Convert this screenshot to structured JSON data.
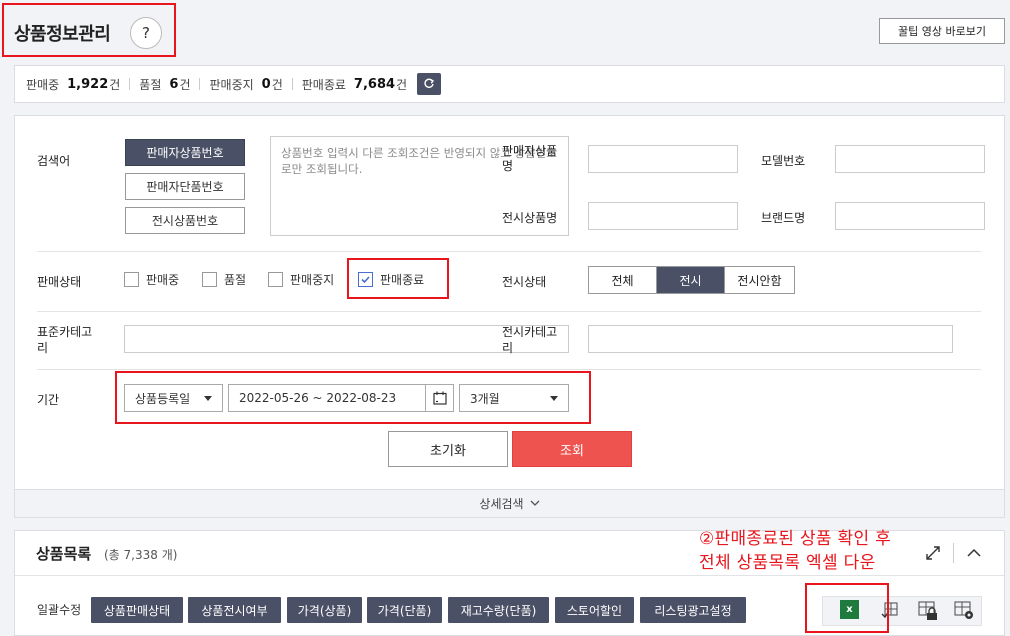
{
  "header": {
    "title": "상품정보관리",
    "help_label": "?",
    "video_button": "꿀팁 영상 바로보기"
  },
  "status": {
    "items": [
      {
        "label": "판매중",
        "count": "1,922",
        "unit": "건"
      },
      {
        "label": "품절",
        "count": "6",
        "unit": "건"
      },
      {
        "label": "판매중지",
        "count": "0",
        "unit": "건"
      },
      {
        "label": "판매종료",
        "count": "7,684",
        "unit": "건"
      }
    ]
  },
  "search": {
    "keyword_label": "검색어",
    "keyword_buttons": [
      "판매자상품번호",
      "판매자단품번호",
      "전시상품번호"
    ],
    "keyword_placeholder": "상품번호 입력시 다른 조회조건은 반영되지 않고 상품번호로만 조회됩니다.",
    "fields": {
      "seller_product_name": "판매자상품명",
      "model_no": "모델번호",
      "display_product_name": "전시상품명",
      "brand_name": "브랜드명"
    },
    "sale_status_label": "판매상태",
    "sale_status_options": [
      {
        "label": "판매중",
        "checked": false
      },
      {
        "label": "품절",
        "checked": false
      },
      {
        "label": "판매중지",
        "checked": false
      },
      {
        "label": "판매종료",
        "checked": true
      }
    ],
    "display_status_label": "전시상태",
    "display_status_options": [
      "전체",
      "전시",
      "전시안함"
    ],
    "display_status_selected": "전시",
    "std_category_label": "표준카테고리",
    "display_category_label": "전시카테고리",
    "period_label": "기간",
    "period_type": "상품등록일",
    "date_range": "2022-05-26 ~ 2022-08-23",
    "period_preset": "3개월",
    "reset_button": "초기화",
    "search_button": "조회",
    "detail_search": "상세검색"
  },
  "list": {
    "title": "상품목록",
    "total": "(총 7,338 개)",
    "bulk_label": "일괄수정",
    "bulk_buttons": [
      "상품판매상태",
      "상품전시여부",
      "가격(상품)",
      "가격(단품)",
      "재고수량(단품)",
      "스토어할인",
      "리스팅광고설정"
    ],
    "excel_label": "x"
  },
  "annotation": {
    "line1": "②판매종료된 상품 확인 후",
    "line2": "전체 상품목록 엑셀 다운"
  },
  "colors": {
    "accent_dark": "#4a5166",
    "search_red": "#ef5350",
    "highlight_red": "#e8151c",
    "excel_green": "#1f7a3e"
  }
}
